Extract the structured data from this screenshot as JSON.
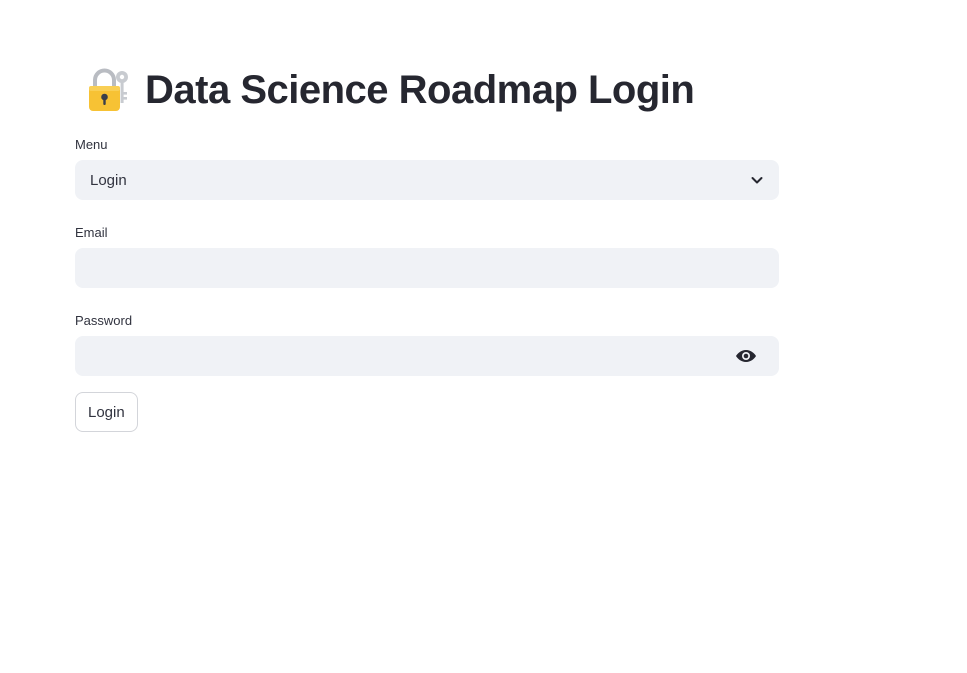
{
  "header": {
    "title": "Data Science Roadmap Login",
    "icon": "lock-with-key-icon"
  },
  "menu": {
    "label": "Menu",
    "selected": "Login"
  },
  "email": {
    "label": "Email",
    "value": ""
  },
  "password": {
    "label": "Password",
    "value": ""
  },
  "login_button": {
    "label": "Login"
  },
  "colors": {
    "input_bg": "#f0f2f6",
    "text": "#31333f",
    "title": "#262730",
    "lock_body": "#f7c234",
    "key": "#c8cbd0"
  }
}
